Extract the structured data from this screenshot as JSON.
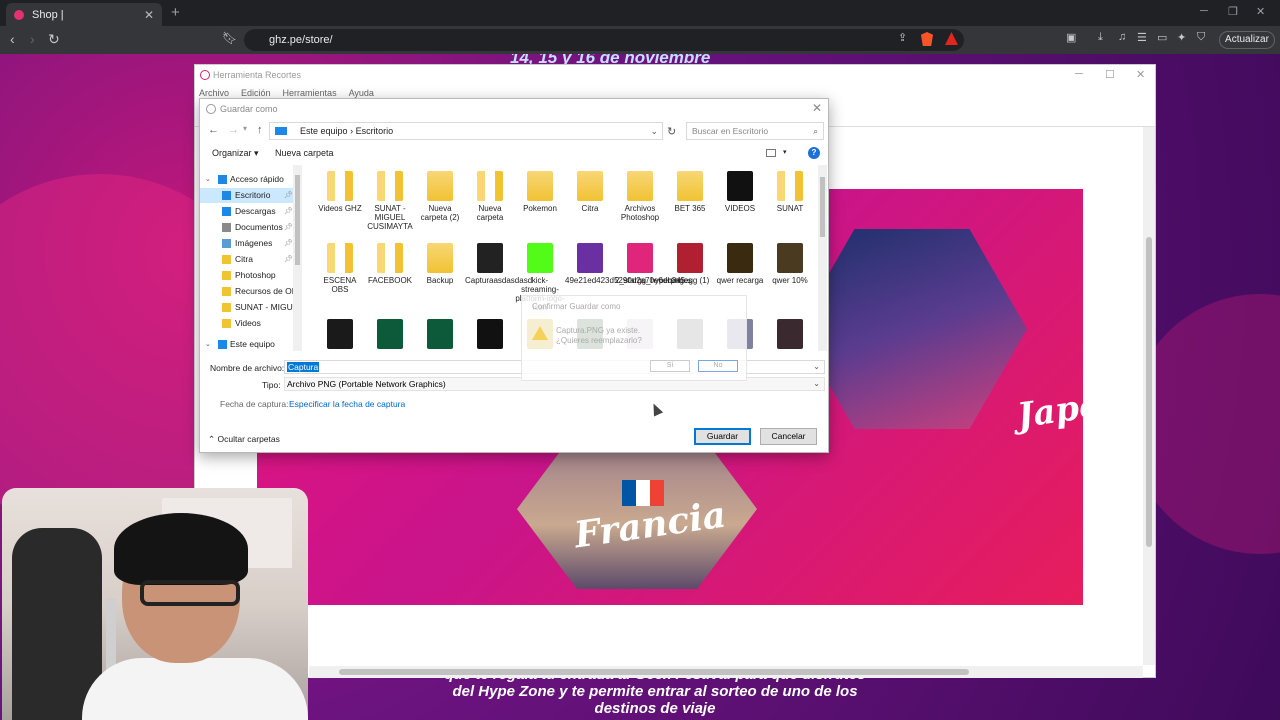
{
  "browser": {
    "tab_title": "Shop |",
    "url": "ghz.pe/store/",
    "update_label": "Actualizar"
  },
  "site": {
    "headline": "14, 15 y 16 de noviembre",
    "footer_line1": "que te regala tu entrada al Geek Festival para que disfrutes",
    "footer_line2": "del Hype Zone y te permite entrar al sorteo de uno de los",
    "footer_line3": "destinos de viaje"
  },
  "snipping_tool": {
    "title": "Herramienta Recortes",
    "menu": [
      "Archivo",
      "Edición",
      "Herramientas",
      "Ayuda"
    ],
    "poster": {
      "word_france": "Francia",
      "word_japan": "Japón"
    }
  },
  "save_dialog": {
    "title": "Guardar como",
    "path": [
      "Este equipo",
      "Escritorio"
    ],
    "search_placeholder": "Buscar en Escritorio",
    "organize_label": "Organizar",
    "new_folder_label": "Nueva carpeta",
    "nav": [
      {
        "label": "Acceso rápido",
        "root": true
      },
      {
        "label": "Escritorio",
        "selected": true,
        "pinned": true
      },
      {
        "label": "Descargas",
        "pinned": true
      },
      {
        "label": "Documentos",
        "pinned": true
      },
      {
        "label": "Imágenes",
        "pinned": true
      },
      {
        "label": "Citra",
        "pinned": true
      },
      {
        "label": "Photoshop"
      },
      {
        "label": "Recursos de OBS"
      },
      {
        "label": "SUNAT - MIGUEL"
      },
      {
        "label": "Videos"
      },
      {
        "label": "Este equipo",
        "root": true
      }
    ],
    "files_row1": [
      "Videos GHZ",
      "SUNAT - MIGUEL CUSIMAYTA",
      "Nueva carpeta (2)",
      "Nueva carpeta",
      "Pokemon",
      "Citra",
      "Archivos Photoshop",
      "BET 365",
      "VIDEOS",
      "SUNAT"
    ],
    "files_row2": [
      "ESCENA OBS",
      "FACEBOOK",
      "Backup",
      "Capturaasdasdasd",
      "kick-streaming-platform-logo-icon",
      "49e21ed423d5290d2a70e6db345...",
      "2_stargg_hyperseries",
      "pngegg (1)",
      "qwer recarga",
      "qwer 10%"
    ],
    "confirm": {
      "title": "Confirmar Guardar como",
      "message_line1": "Captura.PNG ya existe.",
      "message_line2": "¿Quieres reemplazarlo?",
      "yes_label": "Sí",
      "no_label": "No"
    },
    "filename_label": "Nombre de archivo:",
    "filename_value": "Captura",
    "type_label": "Tipo:",
    "type_value": "Archivo PNG (Portable Network Graphics)",
    "date_label": "Fecha de captura:",
    "date_link": "Especificar la fecha de captura",
    "hide_folders_label": "Ocultar carpetas",
    "save_label": "Guardar",
    "cancel_label": "Cancelar"
  }
}
